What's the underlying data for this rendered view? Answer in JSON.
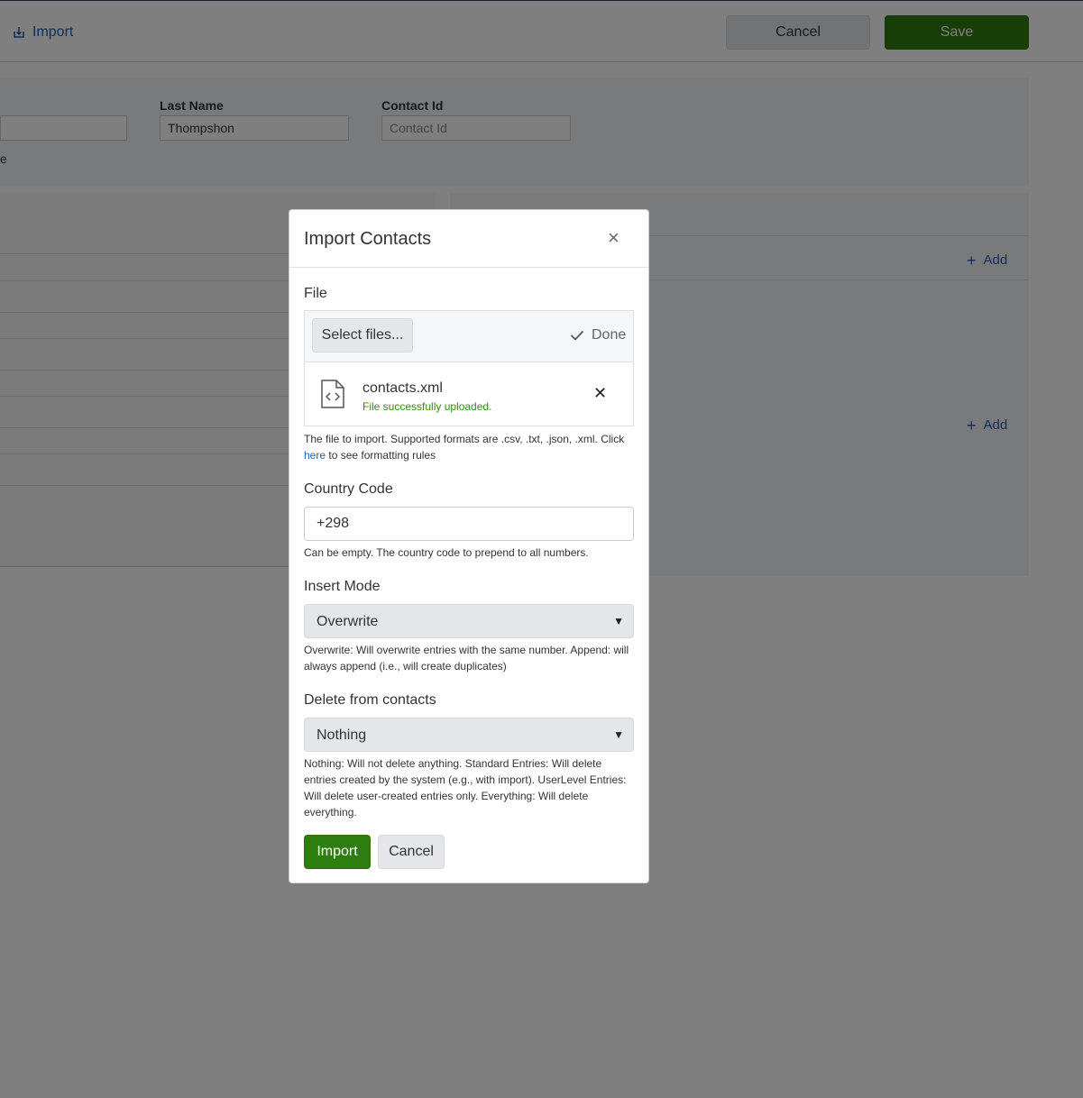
{
  "topbar": {
    "import_label": "Import",
    "import_icon": "import-icon",
    "cancel_label": "Cancel",
    "save_label": "Save"
  },
  "form": {
    "first_name_suffix_text": "e",
    "last_name_label": "Last Name",
    "last_name_value": "Thompshon",
    "contact_id_label": "Contact Id",
    "contact_id_placeholder": "Contact Id"
  },
  "right_panel": {
    "add_label_1": "Add",
    "add_label_2": "Add"
  },
  "modal": {
    "title": "Import Contacts",
    "close_icon": "close-icon",
    "file_label": "File",
    "select_files_label": "Select files...",
    "done_label": "Done",
    "file_name": "contacts.xml",
    "file_status": "File successfully uploaded.",
    "file_help_prefix": "The file to import. Supported formats are .csv, .txt, .json, .xml. Click",
    "file_help_link": "here",
    "file_help_suffix": "to see formatting rules",
    "country_code_label": "Country Code",
    "country_code_value": "+298",
    "country_code_help": "Can be empty. The country code to prepend to all numbers.",
    "insert_mode_label": "Insert Mode",
    "insert_mode_value": "Overwrite",
    "insert_mode_help": "Overwrite: Will overwrite entries with the same number. Append: will always append (i.e., will create duplicates)",
    "delete_label": "Delete from contacts",
    "delete_value": "Nothing",
    "delete_help": "Nothing: Will not delete anything. Standard Entries: Will delete entries created by the system (e.g., with import). UserLevel Entries: Will delete user-created entries only. Everything: Will delete everything.",
    "import_button": "Import",
    "cancel_button": "Cancel"
  },
  "colors": {
    "primary_green": "#2e7d0f",
    "link_blue": "#2a5db0",
    "success_green": "#3a8a12"
  }
}
